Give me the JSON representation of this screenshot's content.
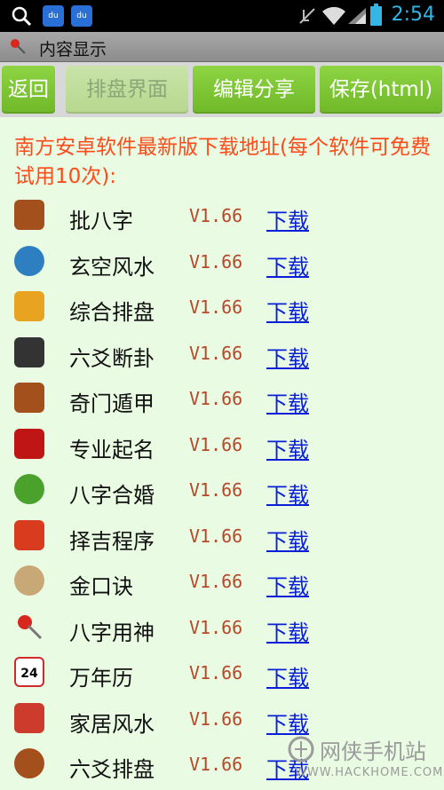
{
  "status_bar": {
    "time": "2:54",
    "icons": [
      "search-icon",
      "baidu-icon",
      "baidu-icon",
      "mute-icon",
      "wifi-icon",
      "signal-icon",
      "battery-icon"
    ],
    "baidu_label": "du"
  },
  "title_bar": {
    "title": "内容显示",
    "icon": "pin-icon"
  },
  "toolbar": {
    "back_label": "返回",
    "layout_label": "排盘界面",
    "share_label": "编辑分享",
    "save_label": "保存(html)"
  },
  "heading": "南方安卓软件最新版下载地址(每个软件可免费试用10次):",
  "apps": [
    {
      "name": "批八字",
      "version": "V1.66",
      "link": "下载",
      "icon": "wheel-icon",
      "color": "#a4501d"
    },
    {
      "name": "玄空风水",
      "version": "V1.66",
      "link": "下载",
      "icon": "globe-icon",
      "color": "#2d7fc1"
    },
    {
      "name": "综合排盘",
      "version": "V1.66",
      "link": "下载",
      "icon": "tiger-icon",
      "color": "#e8a320"
    },
    {
      "name": "六爻断卦",
      "version": "V1.66",
      "link": "下载",
      "icon": "hexagram-icon",
      "color": "#333333"
    },
    {
      "name": "奇门遁甲",
      "version": "V1.66",
      "link": "下载",
      "icon": "gate-icon",
      "color": "#a4501d"
    },
    {
      "name": "专业起名",
      "version": "V1.66",
      "link": "下载",
      "icon": "red-book-icon",
      "color": "#c01515"
    },
    {
      "name": "八字合婚",
      "version": "V1.66",
      "link": "下载",
      "icon": "green-mask-icon",
      "color": "#4aa12c"
    },
    {
      "name": "择吉程序",
      "version": "V1.66",
      "link": "下载",
      "icon": "calendar-flip-icon",
      "color": "#d83b1e"
    },
    {
      "name": "金口诀",
      "version": "V1.66",
      "link": "下载",
      "icon": "compass-icon",
      "color": "#c9a877"
    },
    {
      "name": "八字用神",
      "version": "V1.66",
      "link": "下载",
      "icon": "pin-icon",
      "color": "#d8281e"
    },
    {
      "name": "万年历",
      "version": "V1.66",
      "link": "下载",
      "icon": "calendar-icon",
      "color": "#cf2b2b"
    },
    {
      "name": "家居风水",
      "version": "V1.66",
      "link": "下载",
      "icon": "house-icon",
      "color": "#cc3b2b"
    },
    {
      "name": "六爻排盘",
      "version": "V1.66",
      "link": "下载",
      "icon": "yinyang-icon",
      "color": "#a4501d"
    }
  ],
  "calendar_day": "24",
  "watermark": {
    "title": "网侠手机站",
    "url": "WWW.HACKHOME.COM"
  }
}
